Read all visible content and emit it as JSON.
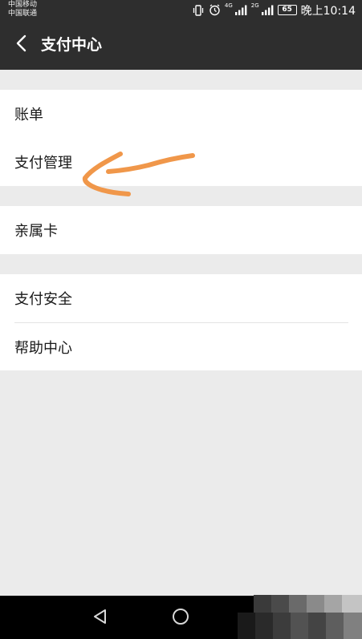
{
  "status_bar": {
    "carrier_1": "中国移动",
    "carrier_2": "中国联通",
    "net_tag_1": "4G",
    "net_tag_2": "2G",
    "battery": "65",
    "time": "晚上10:14"
  },
  "header": {
    "title": "支付中心"
  },
  "menu": {
    "group_1": [
      {
        "label": "账单"
      },
      {
        "label": "支付管理"
      }
    ],
    "group_2": [
      {
        "label": "亲属卡"
      }
    ],
    "group_3": [
      {
        "label": "支付安全"
      },
      {
        "label": "帮助中心"
      }
    ]
  },
  "colors": {
    "header_bg": "#2e2e2e",
    "page_bg": "#ebebeb",
    "annotation_arrow": "#f0974a"
  },
  "icons": {
    "back": "chevron-left-icon",
    "nav_back": "triangle-back-icon",
    "nav_home": "circle-home-icon"
  }
}
